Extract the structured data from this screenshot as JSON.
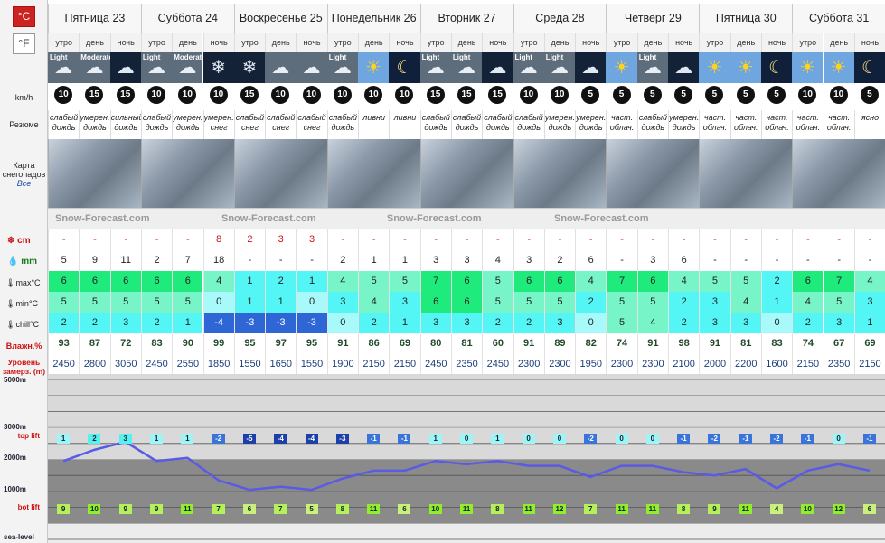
{
  "units": {
    "c_label": "°C",
    "f_label": "°F"
  },
  "labels": {
    "wind": "km/h",
    "summary": "Резюме",
    "map": "Карта снегопадов",
    "map_sub": "Все",
    "snow": "cm",
    "rain": "mm",
    "max": "max°C",
    "min": "min°C",
    "chill": "chill°C",
    "humidity": "Влажн.%",
    "freeze": "Уровень замерз. (m)"
  },
  "chart_labels": {
    "y5000": "5000m",
    "y3000": "3000m",
    "y2000": "2000m",
    "y1000": "1000m",
    "sea": "sea-level",
    "top_lift": "top lift",
    "bot_lift": "bot lift"
  },
  "ad_text": "Snow-Forecast.com",
  "days": [
    {
      "name": "Пятница 23",
      "cols": 3
    },
    {
      "name": "Суббота 24",
      "cols": 3
    },
    {
      "name": "Воскресенье 25",
      "cols": 3
    },
    {
      "name": "Понедельник 26",
      "cols": 3
    },
    {
      "name": "Вторник 27",
      "cols": 3
    },
    {
      "name": "Среда 28",
      "cols": 3
    },
    {
      "name": "Четверг 29",
      "cols": 3
    },
    {
      "name": "Пятница 30",
      "cols": 3
    },
    {
      "name": "Суббота 31",
      "cols": 3
    }
  ],
  "parts": [
    "утро",
    "день",
    "ночь"
  ],
  "icons": [
    "Light",
    "Moderate",
    "night-rain",
    "Light",
    "Moderate",
    "night-snow",
    "night-snow",
    "cloud",
    "cloud",
    "Light",
    "sun",
    "moon",
    "Light",
    "Light",
    "night-cloud",
    "Light",
    "Light",
    "night-rain",
    "sun",
    "Light",
    "night-rain",
    "sun",
    "sun",
    "moon",
    "sun",
    "sun",
    "moon"
  ],
  "wind": [
    "10",
    "15",
    "15",
    "10",
    "10",
    "10",
    "15",
    "10",
    "10",
    "10",
    "10",
    "10",
    "15",
    "15",
    "15",
    "10",
    "10",
    "5",
    "5",
    "5",
    "5",
    "5",
    "5",
    "5",
    "10",
    "10",
    "5"
  ],
  "summary": [
    "слабый дождь",
    "умерен. дождь",
    "сильный дождь",
    "слабый дождь",
    "умерен. дождь",
    "умерен. снег",
    "слабый снег",
    "слабый снег",
    "слабый снег",
    "слабый дождь",
    "ливни",
    "ливни",
    "слабый дождь",
    "слабый дождь",
    "слабый дождь",
    "слабый дождь",
    "умерен. дождь",
    "умерен. дождь",
    "част. облач.",
    "слабый дождь",
    "умерен. дождь",
    "част. облач.",
    "част. облач.",
    "част. облач.",
    "част. облач.",
    "част. облач.",
    "ясно"
  ],
  "snow": [
    "-",
    "-",
    "-",
    "-",
    "-",
    "8",
    "2",
    "3",
    "3",
    "-",
    "-",
    "-",
    "-",
    "-",
    "-",
    "-",
    "-",
    "-",
    "-",
    "-",
    "-",
    "-",
    "-",
    "-",
    "-",
    "-",
    "-"
  ],
  "rain": [
    "5",
    "9",
    "11",
    "2",
    "7",
    "18",
    "-",
    "-",
    "-",
    "2",
    "1",
    "1",
    "3",
    "3",
    "4",
    "3",
    "2",
    "6",
    "-",
    "3",
    "6",
    "-",
    "-",
    "-",
    "-",
    "-",
    "-"
  ],
  "max": [
    "6",
    "6",
    "6",
    "6",
    "6",
    "4",
    "1",
    "2",
    "1",
    "4",
    "5",
    "5",
    "7",
    "6",
    "5",
    "6",
    "6",
    "4",
    "7",
    "6",
    "4",
    "5",
    "5",
    "2",
    "6",
    "7",
    "4"
  ],
  "min": [
    "5",
    "5",
    "5",
    "5",
    "5",
    "0",
    "1",
    "1",
    "0",
    "3",
    "4",
    "3",
    "6",
    "6",
    "5",
    "5",
    "5",
    "2",
    "5",
    "5",
    "2",
    "3",
    "4",
    "1",
    "4",
    "5",
    "3"
  ],
  "chill": [
    "2",
    "2",
    "3",
    "2",
    "1",
    "-4",
    "-3",
    "-3",
    "-3",
    "0",
    "2",
    "1",
    "3",
    "3",
    "2",
    "2",
    "3",
    "0",
    "5",
    "4",
    "2",
    "3",
    "3",
    "0",
    "2",
    "3",
    "1"
  ],
  "humidity": [
    "93",
    "87",
    "72",
    "83",
    "90",
    "99",
    "95",
    "97",
    "95",
    "91",
    "86",
    "69",
    "80",
    "81",
    "60",
    "91",
    "89",
    "82",
    "74",
    "91",
    "98",
    "91",
    "81",
    "83",
    "74",
    "67",
    "69"
  ],
  "freeze": [
    "2450",
    "2800",
    "3050",
    "2450",
    "2550",
    "1850",
    "1550",
    "1650",
    "1550",
    "1900",
    "2150",
    "2150",
    "2450",
    "2350",
    "2450",
    "2300",
    "2300",
    "1950",
    "2300",
    "2300",
    "2100",
    "2000",
    "2200",
    "1600",
    "2150",
    "2350",
    "2150"
  ],
  "top_temps": [
    "1",
    "2",
    "3",
    "1",
    "1",
    "-2",
    "-5",
    "-4",
    "-4",
    "-3",
    "-1",
    "-1",
    "1",
    "0",
    "1",
    "0",
    "0",
    "-2",
    "0",
    "0",
    "-1",
    "-2",
    "-1",
    "-2",
    "-1",
    "0",
    "-1"
  ],
  "bot_temps": [
    "9",
    "10",
    "9",
    "9",
    "11",
    "7",
    "6",
    "7",
    "5",
    "8",
    "11",
    "6",
    "10",
    "11",
    "8",
    "11",
    "12",
    "7",
    "11",
    "11",
    "8",
    "9",
    "11",
    "4",
    "10",
    "12",
    "6"
  ]
}
